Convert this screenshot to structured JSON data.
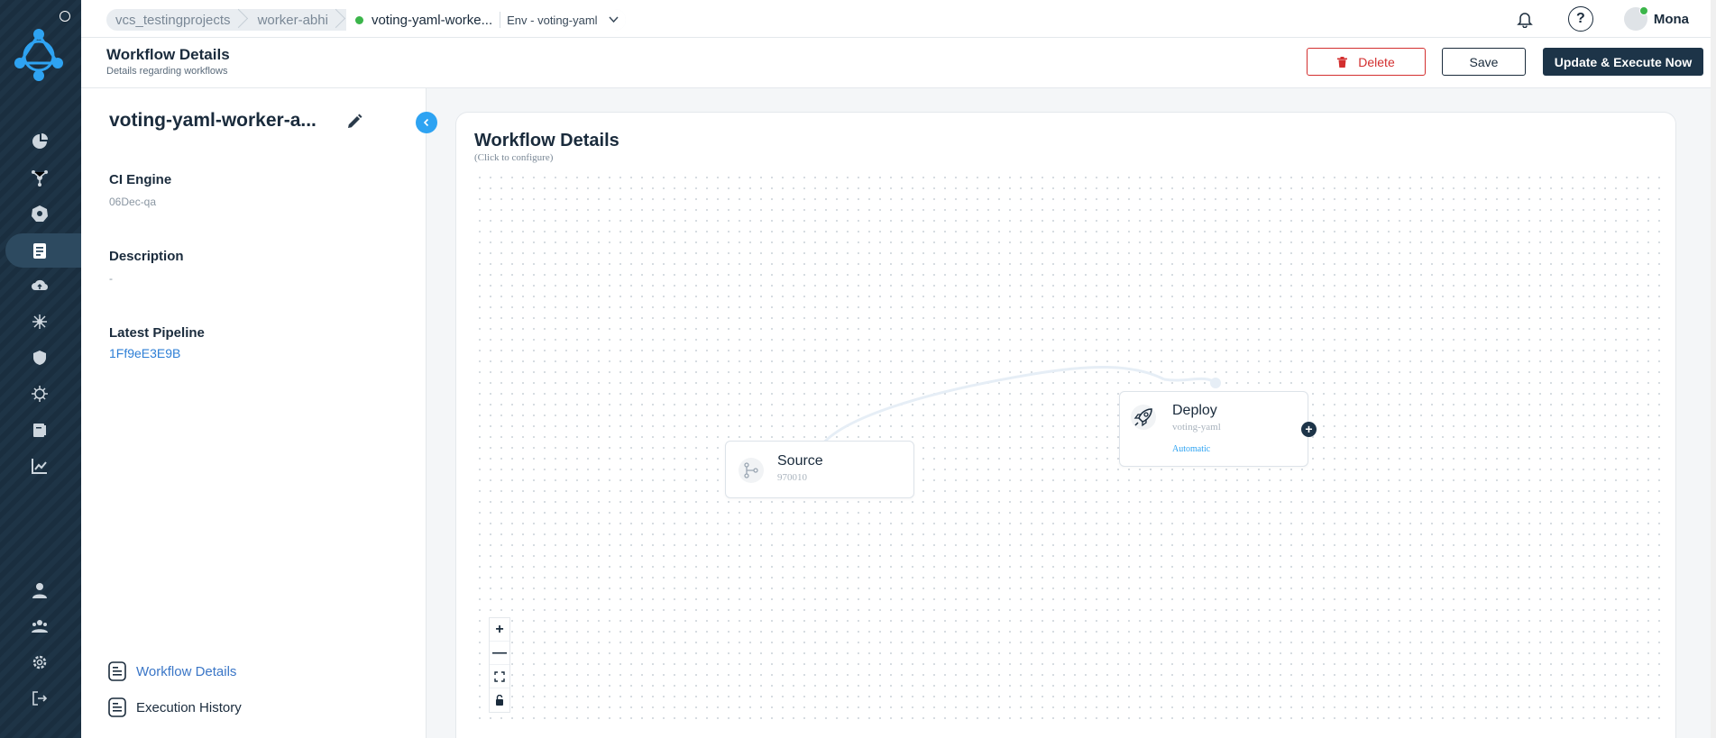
{
  "topbar": {
    "breadcrumbs": [
      "vcs_testingprojects",
      "worker-abhi"
    ],
    "current_workflow": "voting-yaml-worke...",
    "environment": "Env - voting-yaml",
    "help_symbol": "?",
    "user_name": "Mona"
  },
  "header": {
    "title": "Workflow Details",
    "subtitle": "Details regarding workflows",
    "delete_label": "Delete",
    "save_label": "Save",
    "execute_label": "Update & Execute Now"
  },
  "panel": {
    "workflow_name": "voting-yaml-worker-a...",
    "ci_engine_label": "CI Engine",
    "ci_engine_value": "06Dec-qa",
    "description_label": "Description",
    "description_value": "-",
    "latest_pipeline_label": "Latest Pipeline",
    "latest_pipeline_value": "1Ff9eE3E9B",
    "nav": [
      "Workflow Details",
      "Execution History"
    ]
  },
  "canvas": {
    "title": "Workflow Details",
    "hint": "(Click to configure)",
    "nodes": {
      "source": {
        "title": "Source",
        "sub": "970010"
      },
      "deploy": {
        "title": "Deploy",
        "sub": "voting-yaml",
        "tag": "Automatic"
      }
    },
    "zoom_in": "+",
    "zoom_out": "—"
  },
  "colors": {
    "rail": "#1e3446",
    "primary": "#1d3448",
    "danger": "#d32f2f",
    "link": "#2e7fd6",
    "accent": "#2ea3f2",
    "status": "#3bb54a"
  },
  "icons": [
    "logo-icon",
    "dashboard-icon",
    "network-icon",
    "kubernetes-icon",
    "workflow-icon",
    "cloud-upload-icon",
    "integrations-icon",
    "shield-icon",
    "helm-icon",
    "catalog-icon",
    "analytics-icon",
    "user-icon",
    "team-icon",
    "gear-icon",
    "logout-icon",
    "bell-icon",
    "help-icon",
    "trash-icon",
    "pencil-icon",
    "chevron-left-icon",
    "document-icon",
    "rocket-icon",
    "git-branch-icon",
    "lock-icon"
  ]
}
